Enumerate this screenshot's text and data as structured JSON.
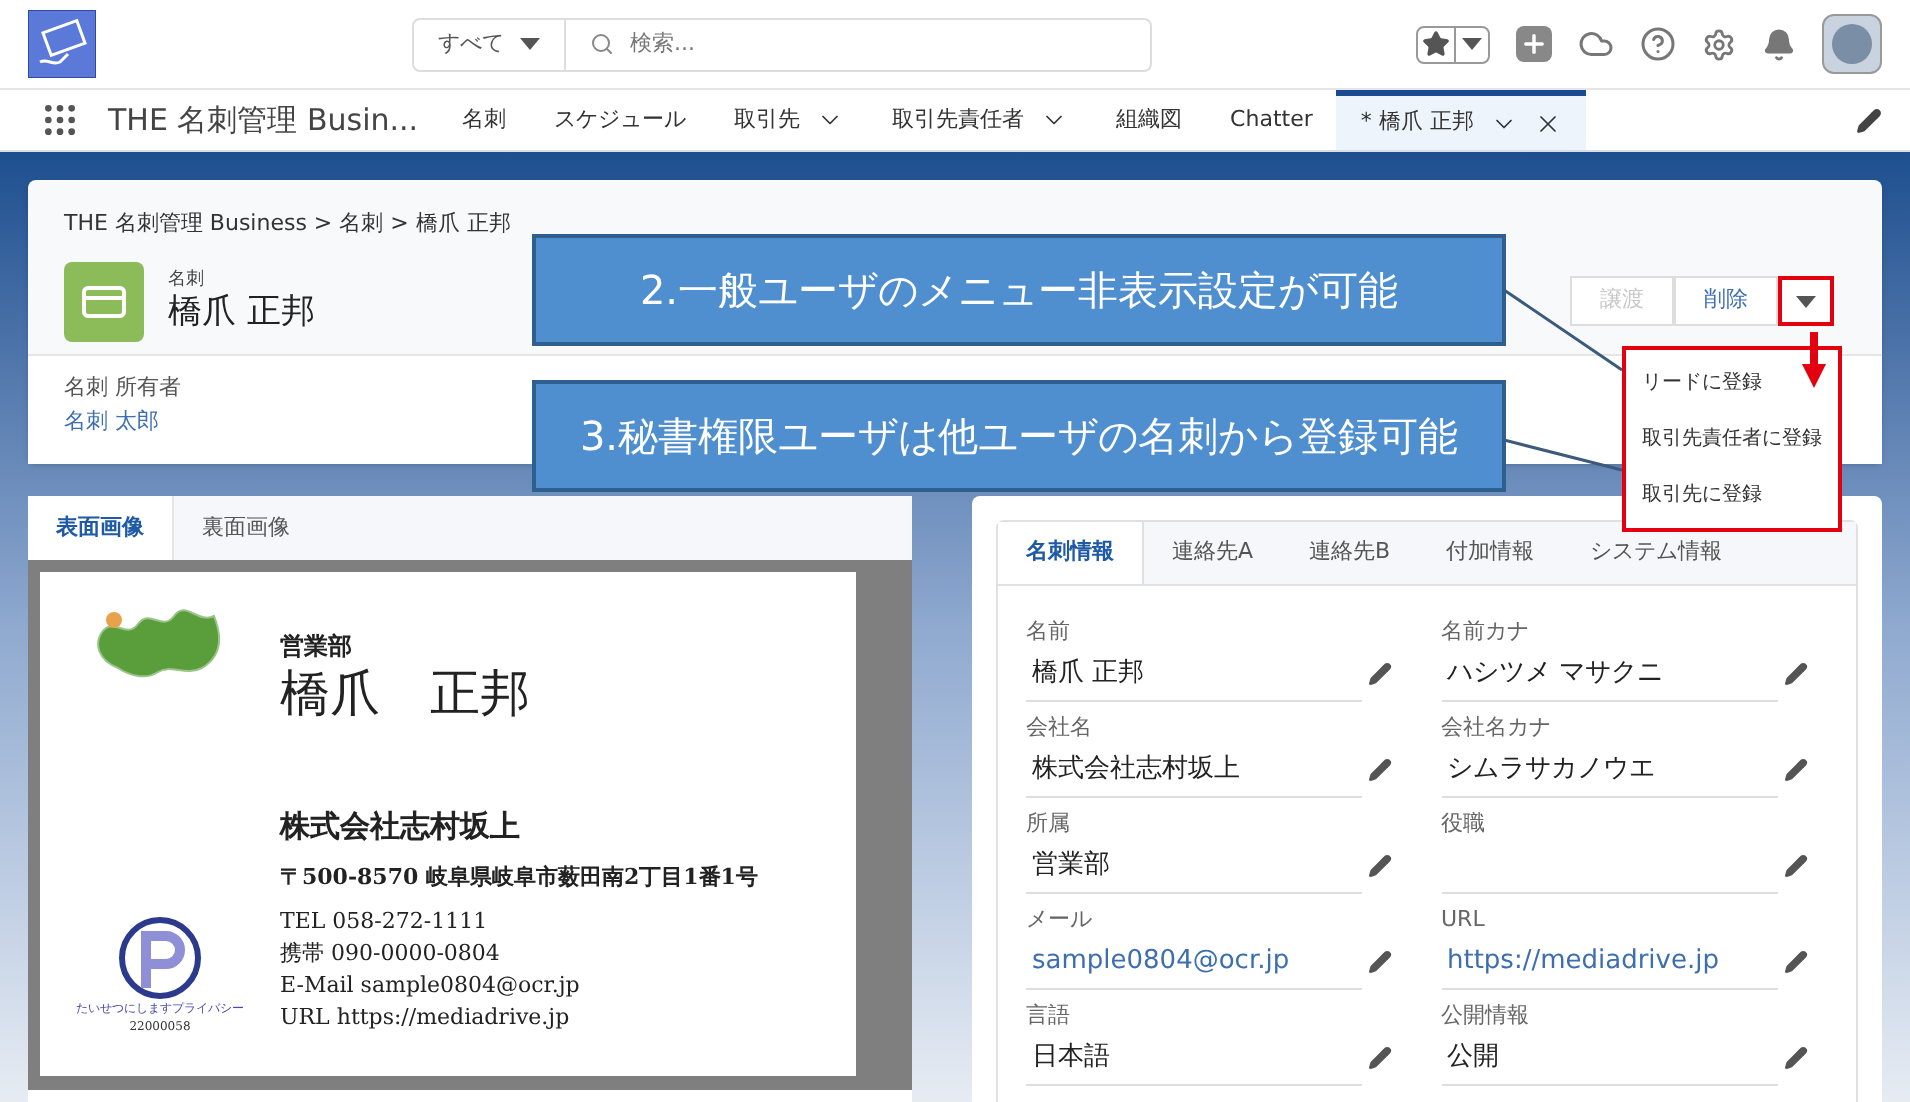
{
  "header": {
    "search_scope": "すべて",
    "search_placeholder": "検索..."
  },
  "nav": {
    "app_name": "THE 名刺管理 Busin...",
    "items": [
      {
        "label": "名刺",
        "dropdown": false,
        "closable": false,
        "selected": false
      },
      {
        "label": "スケジュール",
        "dropdown": false,
        "closable": false,
        "selected": false
      },
      {
        "label": "取引先",
        "dropdown": true,
        "closable": false,
        "selected": false
      },
      {
        "label": "取引先責任者",
        "dropdown": true,
        "closable": false,
        "selected": false
      },
      {
        "label": "組織図",
        "dropdown": false,
        "closable": false,
        "selected": false
      },
      {
        "label": "Chatter",
        "dropdown": false,
        "closable": false,
        "selected": false
      },
      {
        "label": "* 橋爪 正邦",
        "dropdown": true,
        "closable": true,
        "selected": true
      }
    ]
  },
  "record": {
    "breadcrumb": "THE 名刺管理 Business > 名刺 > 橋爪 正邦",
    "object_label": "名刺",
    "title": "橋爪 正邦",
    "owner_label": "名刺 所有者",
    "owner": "名刺 太郎",
    "actions": [
      {
        "label": "譲渡",
        "disabled": true
      },
      {
        "label": "削除",
        "disabled": false
      }
    ],
    "menu": [
      "リードに登録",
      "取引先責任者に登録",
      "取引先に登録"
    ]
  },
  "callouts": [
    "2.一般ユーザのメニュー非表示設定が可能",
    "3.秘書権限ユーザは他ユーザの名刺から登録可能"
  ],
  "image_tabs": [
    {
      "label": "表面画像",
      "selected": true
    },
    {
      "label": "裏面画像",
      "selected": false
    }
  ],
  "card": {
    "department": "営業部",
    "name": "橋爪　正邦",
    "company": "株式会社志村坂上",
    "address": "〒500-8570 岐阜県岐阜市薮田南2丁目1番1号",
    "lines": [
      "TEL 058-272-1111",
      "携帯 090-0000-0804",
      "E-Mail sample0804@ocr.jp",
      "URL https://mediadrive.jp"
    ],
    "mark_number": "22000058",
    "mark_caption": "たいせつにしますプライバシー"
  },
  "detail_tabs": [
    {
      "label": "名刺情報",
      "selected": true
    },
    {
      "label": "連絡先A",
      "selected": false
    },
    {
      "label": "連絡先B",
      "selected": false
    },
    {
      "label": "付加情報",
      "selected": false
    },
    {
      "label": "システム情報",
      "selected": false
    }
  ],
  "fields": [
    {
      "label": "名前",
      "value": "橋爪 正邦",
      "kind": "text"
    },
    {
      "label": "名前カナ",
      "value": "ハシツメ マサクニ",
      "kind": "text"
    },
    {
      "label": "会社名",
      "value": "株式会社志村坂上",
      "kind": "text"
    },
    {
      "label": "会社名カナ",
      "value": "シムラサカノウエ",
      "kind": "text"
    },
    {
      "label": "所属",
      "value": "営業部",
      "kind": "text"
    },
    {
      "label": "役職",
      "kind": "text"
    },
    {
      "label": "メール",
      "value": "sample0804@ocr.jp",
      "kind": "link"
    },
    {
      "label": "URL",
      "value": "https://mediadrive.jp",
      "kind": "link"
    },
    {
      "label": "言語",
      "value": "日本語",
      "kind": "text"
    },
    {
      "label": "公開情報",
      "value": "公開",
      "kind": "text"
    }
  ]
}
